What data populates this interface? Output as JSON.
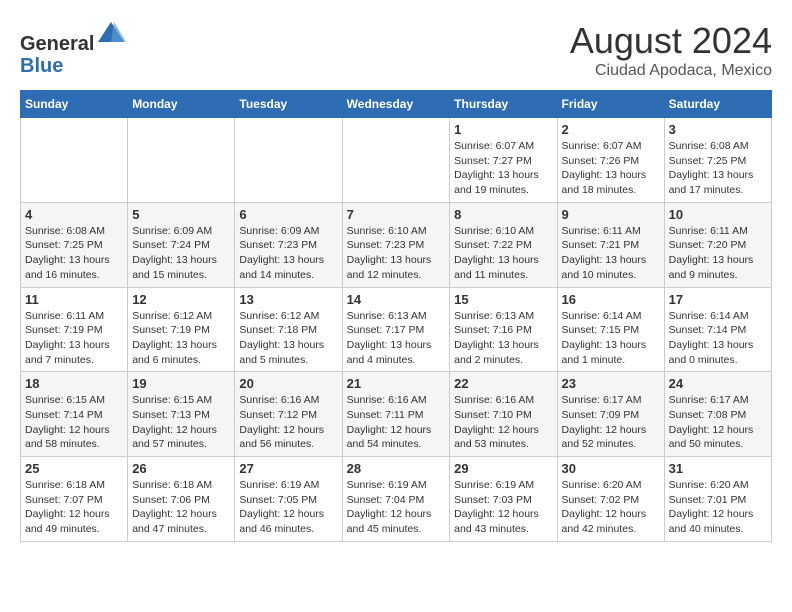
{
  "header": {
    "logo_line1": "General",
    "logo_line2": "Blue",
    "month_year": "August 2024",
    "location": "Ciudad Apodaca, Mexico"
  },
  "weekdays": [
    "Sunday",
    "Monday",
    "Tuesday",
    "Wednesday",
    "Thursday",
    "Friday",
    "Saturday"
  ],
  "weeks": [
    [
      {
        "day": "",
        "info": ""
      },
      {
        "day": "",
        "info": ""
      },
      {
        "day": "",
        "info": ""
      },
      {
        "day": "",
        "info": ""
      },
      {
        "day": "1",
        "info": "Sunrise: 6:07 AM\nSunset: 7:27 PM\nDaylight: 13 hours and 19 minutes."
      },
      {
        "day": "2",
        "info": "Sunrise: 6:07 AM\nSunset: 7:26 PM\nDaylight: 13 hours and 18 minutes."
      },
      {
        "day": "3",
        "info": "Sunrise: 6:08 AM\nSunset: 7:25 PM\nDaylight: 13 hours and 17 minutes."
      }
    ],
    [
      {
        "day": "4",
        "info": "Sunrise: 6:08 AM\nSunset: 7:25 PM\nDaylight: 13 hours and 16 minutes."
      },
      {
        "day": "5",
        "info": "Sunrise: 6:09 AM\nSunset: 7:24 PM\nDaylight: 13 hours and 15 minutes."
      },
      {
        "day": "6",
        "info": "Sunrise: 6:09 AM\nSunset: 7:23 PM\nDaylight: 13 hours and 14 minutes."
      },
      {
        "day": "7",
        "info": "Sunrise: 6:10 AM\nSunset: 7:23 PM\nDaylight: 13 hours and 12 minutes."
      },
      {
        "day": "8",
        "info": "Sunrise: 6:10 AM\nSunset: 7:22 PM\nDaylight: 13 hours and 11 minutes."
      },
      {
        "day": "9",
        "info": "Sunrise: 6:11 AM\nSunset: 7:21 PM\nDaylight: 13 hours and 10 minutes."
      },
      {
        "day": "10",
        "info": "Sunrise: 6:11 AM\nSunset: 7:20 PM\nDaylight: 13 hours and 9 minutes."
      }
    ],
    [
      {
        "day": "11",
        "info": "Sunrise: 6:11 AM\nSunset: 7:19 PM\nDaylight: 13 hours and 7 minutes."
      },
      {
        "day": "12",
        "info": "Sunrise: 6:12 AM\nSunset: 7:19 PM\nDaylight: 13 hours and 6 minutes."
      },
      {
        "day": "13",
        "info": "Sunrise: 6:12 AM\nSunset: 7:18 PM\nDaylight: 13 hours and 5 minutes."
      },
      {
        "day": "14",
        "info": "Sunrise: 6:13 AM\nSunset: 7:17 PM\nDaylight: 13 hours and 4 minutes."
      },
      {
        "day": "15",
        "info": "Sunrise: 6:13 AM\nSunset: 7:16 PM\nDaylight: 13 hours and 2 minutes."
      },
      {
        "day": "16",
        "info": "Sunrise: 6:14 AM\nSunset: 7:15 PM\nDaylight: 13 hours and 1 minute."
      },
      {
        "day": "17",
        "info": "Sunrise: 6:14 AM\nSunset: 7:14 PM\nDaylight: 13 hours and 0 minutes."
      }
    ],
    [
      {
        "day": "18",
        "info": "Sunrise: 6:15 AM\nSunset: 7:14 PM\nDaylight: 12 hours and 58 minutes."
      },
      {
        "day": "19",
        "info": "Sunrise: 6:15 AM\nSunset: 7:13 PM\nDaylight: 12 hours and 57 minutes."
      },
      {
        "day": "20",
        "info": "Sunrise: 6:16 AM\nSunset: 7:12 PM\nDaylight: 12 hours and 56 minutes."
      },
      {
        "day": "21",
        "info": "Sunrise: 6:16 AM\nSunset: 7:11 PM\nDaylight: 12 hours and 54 minutes."
      },
      {
        "day": "22",
        "info": "Sunrise: 6:16 AM\nSunset: 7:10 PM\nDaylight: 12 hours and 53 minutes."
      },
      {
        "day": "23",
        "info": "Sunrise: 6:17 AM\nSunset: 7:09 PM\nDaylight: 12 hours and 52 minutes."
      },
      {
        "day": "24",
        "info": "Sunrise: 6:17 AM\nSunset: 7:08 PM\nDaylight: 12 hours and 50 minutes."
      }
    ],
    [
      {
        "day": "25",
        "info": "Sunrise: 6:18 AM\nSunset: 7:07 PM\nDaylight: 12 hours and 49 minutes."
      },
      {
        "day": "26",
        "info": "Sunrise: 6:18 AM\nSunset: 7:06 PM\nDaylight: 12 hours and 47 minutes."
      },
      {
        "day": "27",
        "info": "Sunrise: 6:19 AM\nSunset: 7:05 PM\nDaylight: 12 hours and 46 minutes."
      },
      {
        "day": "28",
        "info": "Sunrise: 6:19 AM\nSunset: 7:04 PM\nDaylight: 12 hours and 45 minutes."
      },
      {
        "day": "29",
        "info": "Sunrise: 6:19 AM\nSunset: 7:03 PM\nDaylight: 12 hours and 43 minutes."
      },
      {
        "day": "30",
        "info": "Sunrise: 6:20 AM\nSunset: 7:02 PM\nDaylight: 12 hours and 42 minutes."
      },
      {
        "day": "31",
        "info": "Sunrise: 6:20 AM\nSunset: 7:01 PM\nDaylight: 12 hours and 40 minutes."
      }
    ]
  ]
}
